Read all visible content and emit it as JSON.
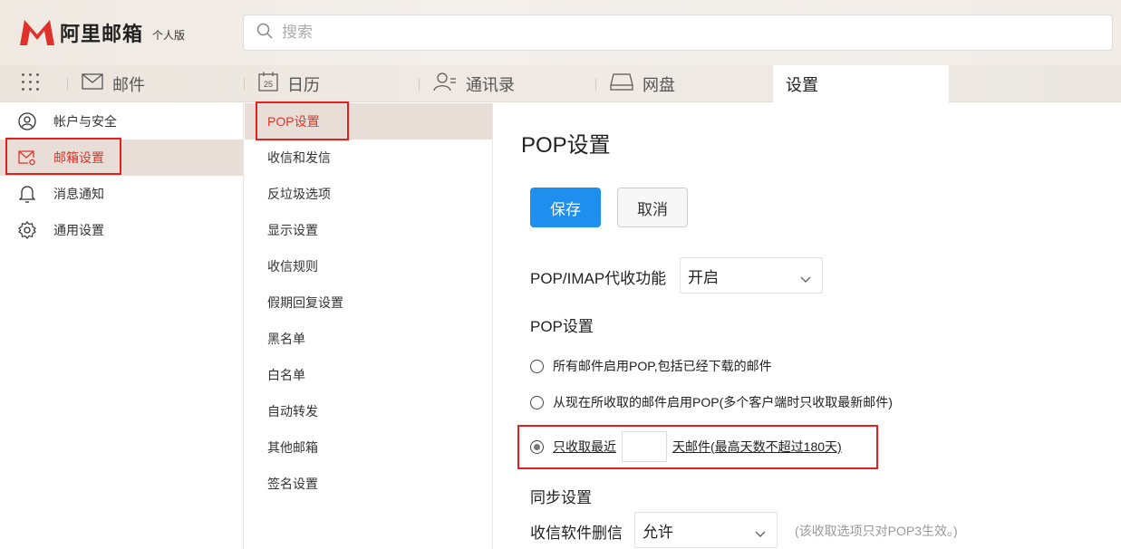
{
  "header": {
    "logo_name": "阿里邮箱",
    "edition": "个人版",
    "search_placeholder": "搜索"
  },
  "tabs": [
    {
      "label": "邮件",
      "icon": "mail-icon"
    },
    {
      "label": "日历",
      "icon": "calendar-icon",
      "badge": "25"
    },
    {
      "label": "通讯录",
      "icon": "contacts-icon"
    },
    {
      "label": "网盘",
      "icon": "drive-icon"
    },
    {
      "label": "设置",
      "active": true
    }
  ],
  "sidebar": {
    "items": [
      {
        "label": "帐户与安全",
        "icon": "user-icon"
      },
      {
        "label": "邮箱设置",
        "icon": "mail-settings-icon",
        "active": true
      },
      {
        "label": "消息通知",
        "icon": "bell-icon"
      },
      {
        "label": "通用设置",
        "icon": "gear-icon"
      }
    ]
  },
  "submenu": {
    "items": [
      {
        "label": "POP设置",
        "active": true
      },
      {
        "label": "收信和发信"
      },
      {
        "label": "反垃圾选项"
      },
      {
        "label": "显示设置"
      },
      {
        "label": "收信规则"
      },
      {
        "label": "假期回复设置"
      },
      {
        "label": "黑名单"
      },
      {
        "label": "白名单"
      },
      {
        "label": "自动转发"
      },
      {
        "label": "其他邮箱"
      },
      {
        "label": "签名设置"
      }
    ]
  },
  "main": {
    "title": "POP设置",
    "save_label": "保存",
    "cancel_label": "取消",
    "pop_imap_label": "POP/IMAP代收功能",
    "pop_imap_value": "开启",
    "pop_section": "POP设置",
    "options": [
      {
        "label": "所有邮件启用POP,包括已经下载的邮件",
        "checked": false
      },
      {
        "label": "从现在所收取的邮件启用POP(多个客户端时只收取最新邮件)",
        "checked": false
      }
    ],
    "recent_prefix": "只收取最近",
    "recent_suffix": "天邮件(最高天数不超过180天)",
    "recent_days_value": "",
    "sync_section": "同步设置",
    "delete_label": "收信软件删信",
    "delete_value": "允许",
    "delete_hint": "(该收取选项只对POP3生效。)"
  },
  "colors": {
    "accent": "#1e8eef",
    "active_text": "#d9362a",
    "active_bg": "#e9ddd8",
    "highlight_box": "#e41f1f"
  }
}
